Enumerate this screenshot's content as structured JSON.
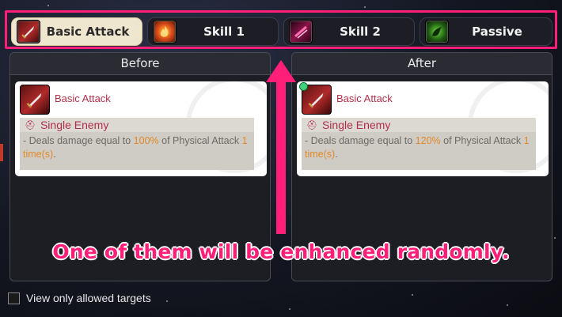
{
  "tabs": [
    {
      "label": "Basic Attack",
      "icon": "sword-icon",
      "active": true
    },
    {
      "label": "Skill 1",
      "icon": "fire-icon",
      "active": false
    },
    {
      "label": "Skill 2",
      "icon": "slash-icon",
      "active": false
    },
    {
      "label": "Passive",
      "icon": "dragon-icon",
      "active": false
    }
  ],
  "before": {
    "header": "Before",
    "skill_name": "Basic Attack",
    "target": "Single Enemy",
    "desc_prefix": "- Deals damage equal to ",
    "desc_percent": "100%",
    "desc_mid": " of Physical Attack ",
    "desc_times": "1 time(s)",
    "desc_suffix": "."
  },
  "after": {
    "header": "After",
    "skill_name": "Basic Attack",
    "target": "Single Enemy",
    "desc_prefix": "- Deals damage equal to ",
    "desc_percent": "120%",
    "desc_mid": " of Physical Attack ",
    "desc_times": "1 time(s)",
    "desc_suffix": "."
  },
  "annotation": "One of them will be enhanced randomly.",
  "view_only_label": "View only allowed targets",
  "colors": {
    "highlight": "#ff1e78",
    "skill_title": "#b0304a",
    "value_highlight": "#e0892a"
  }
}
